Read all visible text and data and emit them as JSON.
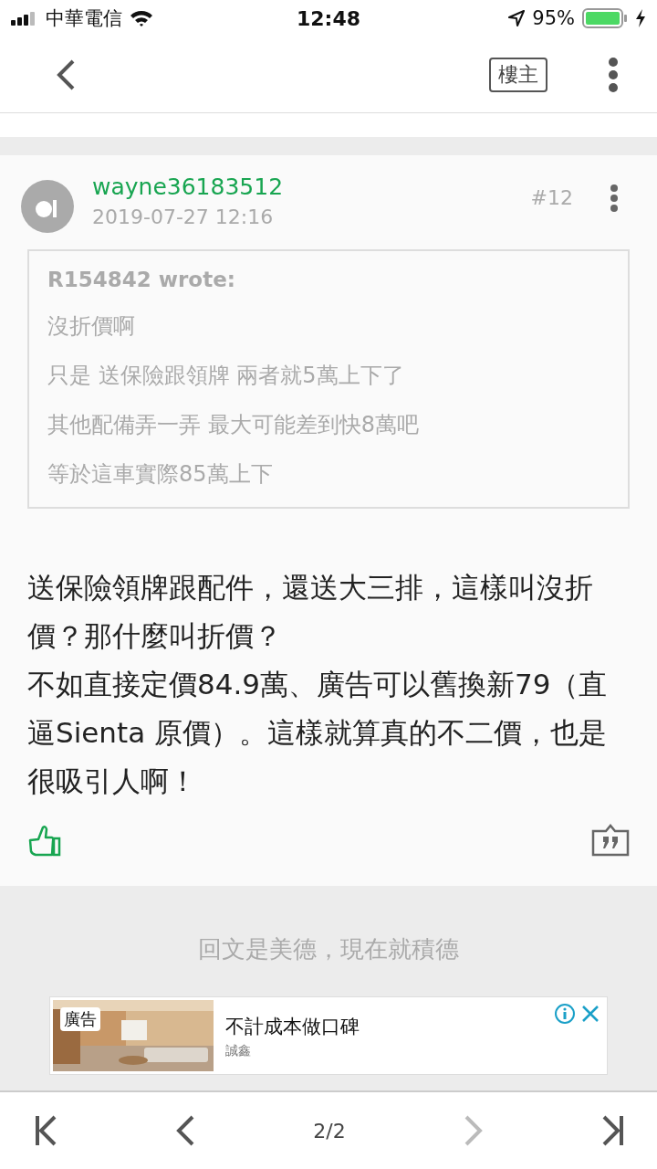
{
  "status_bar": {
    "carrier": "中華電信",
    "time": "12:48",
    "battery": "95%"
  },
  "nav": {
    "op_badge": "樓主"
  },
  "post": {
    "username": "wayne36183512",
    "date": "2019-07-27 12:16",
    "floor": "#12",
    "quote": {
      "author": "R154842 wrote:",
      "lines": [
        "沒折價啊",
        "只是 送保險跟領牌 兩者就5萬上下了",
        "其他配備弄一弄 最大可能差到快8萬吧",
        "等於這車實際85萬上下"
      ]
    },
    "body": [
      "送保險領牌跟配件，還送大三排，這樣叫沒折價？那什麼叫折價？",
      "不如直接定價84.9萬、廣告可以舊換新79（直逼Sienta 原價）。這樣就算真的不二價，也是很吸引人啊！"
    ]
  },
  "reply_prompt": "回文是美德，現在就積德",
  "ad": {
    "tag": "廣告",
    "title": "不計成本做口碑",
    "advertiser": "誠鑫"
  },
  "pager": {
    "page": "2/2",
    "buttons": [
      {
        "kind": "first",
        "disabled": false
      },
      {
        "kind": "prev",
        "disabled": false
      },
      {
        "kind": "next",
        "disabled": true
      },
      {
        "kind": "last",
        "disabled": false
      }
    ]
  }
}
